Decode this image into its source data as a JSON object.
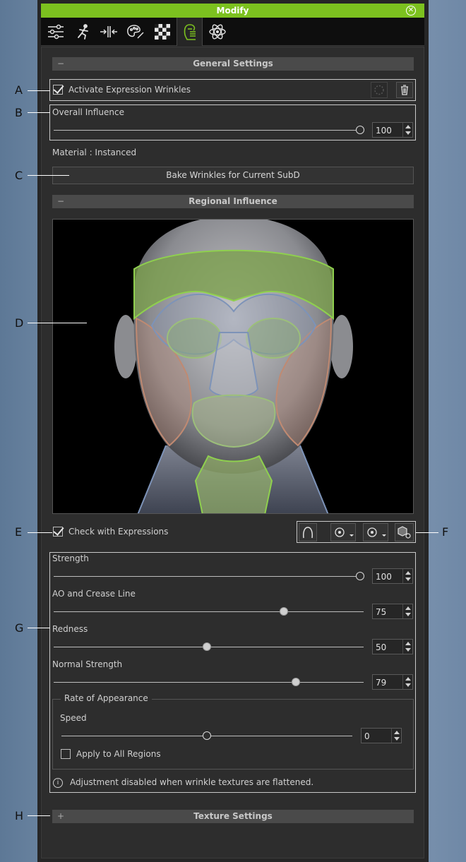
{
  "window": {
    "title": "Modify"
  },
  "tabs": [
    {
      "name": "sliders-icon"
    },
    {
      "name": "pose-icon"
    },
    {
      "name": "morph-icon"
    },
    {
      "name": "palette-icon"
    },
    {
      "name": "checker-icon"
    },
    {
      "name": "wrinkle-face-icon",
      "active": true
    },
    {
      "name": "atom-icon"
    }
  ],
  "general": {
    "header": "General Settings",
    "activate_label": "Activate Expression Wrinkles",
    "activate_checked": true,
    "overall_label": "Overall Influence",
    "overall_value": "100",
    "overall_fraction": 1.0,
    "material_label": "Material : Instanced",
    "bake_button": "Bake Wrinkles for Current SubD"
  },
  "regional": {
    "header": "Regional Influence",
    "check_label": "Check with Expressions",
    "check_checked": true
  },
  "sliders": [
    {
      "label": "Strength",
      "value": "100",
      "fraction": 1.0,
      "knob": "hollow"
    },
    {
      "label": "AO and Crease Line",
      "value": "75",
      "fraction": 0.75,
      "knob": "solid"
    },
    {
      "label": "Redness",
      "value": "50",
      "fraction": 0.5,
      "knob": "solid"
    },
    {
      "label": "Normal Strength",
      "value": "79",
      "fraction": 0.79,
      "knob": "solid"
    }
  ],
  "rate": {
    "title": "Rate of Appearance",
    "speed_label": "Speed",
    "speed_value": "0",
    "speed_fraction": 0.5,
    "apply_label": "Apply to All Regions",
    "apply_checked": false
  },
  "info_text": "Adjustment disabled when wrinkle textures are flattened.",
  "texture": {
    "header": "Texture Settings",
    "sign": "+"
  },
  "collapse_sign": "−",
  "callouts": [
    "A",
    "B",
    "C",
    "D",
    "E",
    "F",
    "G",
    "H"
  ],
  "colors": {
    "accent": "#7cc11f",
    "forehead": "#7ca04e",
    "cheek": "#c08a72",
    "eye": "#8aa77a",
    "chin": "#9ab86b"
  }
}
